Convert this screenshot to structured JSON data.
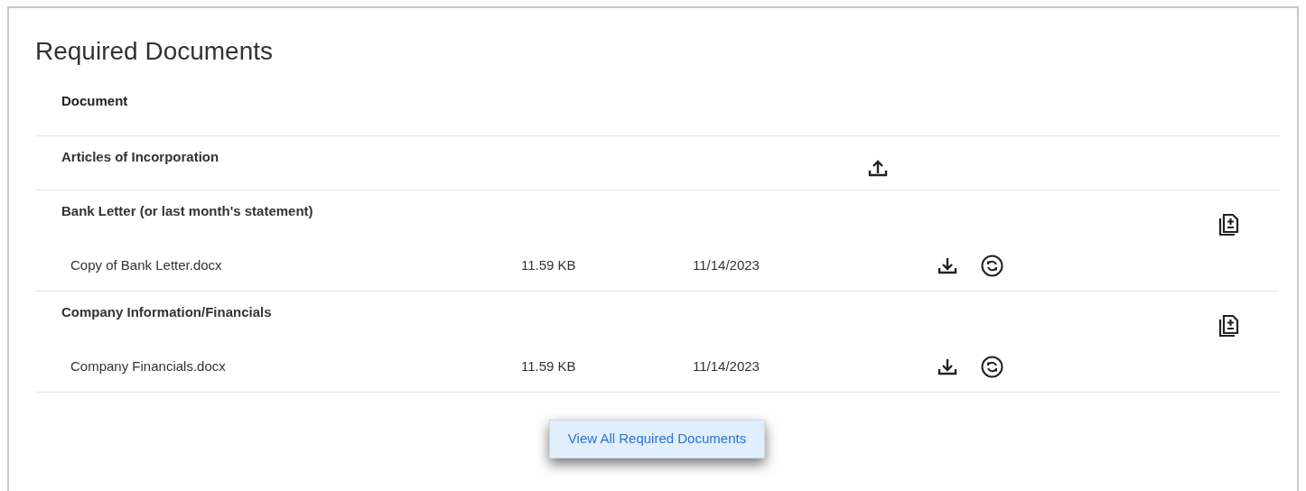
{
  "title": "Required Documents",
  "table": {
    "columns": [
      "Document"
    ],
    "rows": [
      {
        "kind": "upload",
        "name": "Articles of Incorporation"
      },
      {
        "kind": "attached",
        "name": "Bank Letter (or last month's statement)",
        "files": [
          {
            "name": "Copy of Bank Letter.docx",
            "size": "11.59 KB",
            "date": "11/14/2023"
          }
        ]
      },
      {
        "kind": "attached",
        "name": "Company Information/Financials",
        "files": [
          {
            "name": "Company Financials.docx",
            "size": "11.59 KB",
            "date": "11/14/2023"
          }
        ]
      }
    ]
  },
  "button": "View All Required Documents"
}
